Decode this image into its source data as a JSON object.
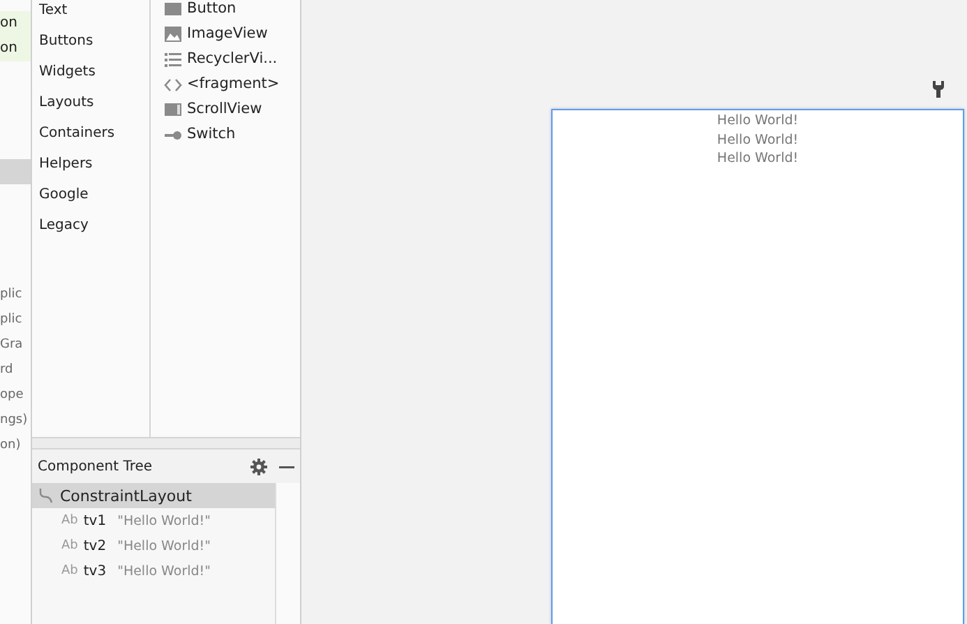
{
  "left_edge": {
    "top_items": [
      {
        "label": "on",
        "highlighted": true
      },
      {
        "label": "on",
        "highlighted": true
      }
    ],
    "selected_row": true,
    "bottom_items": [
      "plic",
      "plic",
      "Gra",
      "rd",
      "ope",
      "ngs)",
      "on)"
    ]
  },
  "palette": {
    "categories": [
      {
        "label": "Text",
        "selected": false
      },
      {
        "label": "Buttons",
        "selected": false
      },
      {
        "label": "Widgets",
        "selected": false
      },
      {
        "label": "Layouts",
        "selected": false
      },
      {
        "label": "Containers",
        "selected": false
      },
      {
        "label": "Helpers",
        "selected": false
      },
      {
        "label": "Google",
        "selected": false
      },
      {
        "label": "Legacy",
        "selected": false
      }
    ],
    "items": [
      {
        "kind": "button",
        "label": "Button"
      },
      {
        "kind": "image",
        "label": "ImageView"
      },
      {
        "kind": "list",
        "label": "RecyclerVi..."
      },
      {
        "kind": "code",
        "label": "<fragment>"
      },
      {
        "kind": "scroll",
        "label": "ScrollView"
      },
      {
        "kind": "switch",
        "label": "Switch"
      }
    ]
  },
  "component_tree": {
    "title": "Component Tree",
    "root": {
      "label": "ConstraintLayout",
      "selected": true,
      "children": [
        {
          "badge": "Ab",
          "label": "tv1",
          "detail": "\"Hello World!\"",
          "selected": false
        },
        {
          "badge": "Ab",
          "label": "tv2",
          "detail": "\"Hello World!\"",
          "selected": false
        },
        {
          "badge": "Ab",
          "label": "tv3",
          "detail": "\"Hello World!\"",
          "selected": false
        }
      ]
    }
  },
  "design": {
    "texts": [
      "Hello World!",
      "Hello World!",
      "Hello World!"
    ]
  }
}
